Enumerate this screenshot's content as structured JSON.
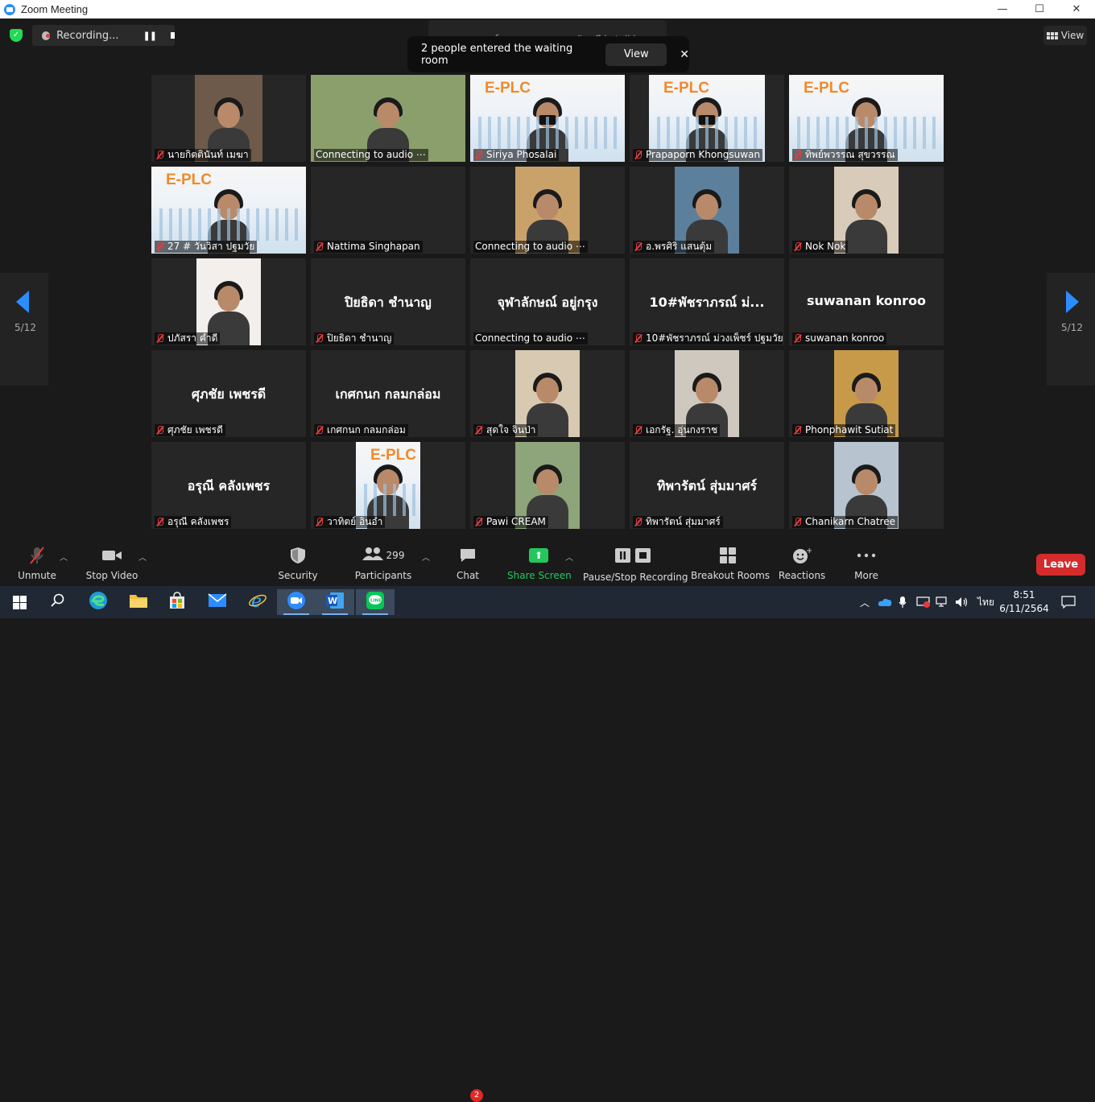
{
  "window": {
    "title": "Zoom Meeting",
    "controls": [
      "—",
      "☐",
      "✕"
    ]
  },
  "meeting_top": {
    "recording_label": "Recording...",
    "talking_text": "คณะครุศาสตร์อุตสาหกรรม มทร.ธัญบุรี is talking...",
    "waiting_message": "2 people entered the waiting room",
    "waiting_view": "View",
    "waiting_close": "✕",
    "view_label": "View"
  },
  "pagination": {
    "left": "5/12",
    "right": "5/12"
  },
  "tiles": [
    {
      "label": "นายกิตตินันท์ เมฆา",
      "muted": true,
      "video": "person",
      "bg": "#6d5a4a",
      "vx": 54,
      "vw": 84
    },
    {
      "label": "Connecting to audio ⋯",
      "muted": false,
      "video": "person",
      "bg": "#8a9f6b",
      "vx": 0,
      "vw": 192
    },
    {
      "label": "Siriya Phosalai",
      "muted": true,
      "video": "plc-mask",
      "vx": 0,
      "vw": 192
    },
    {
      "label": "Prapaporn Khongsuwan",
      "muted": true,
      "video": "plc-mask",
      "vx": 24,
      "vw": 144
    },
    {
      "label": "ทิพย์พวรรณ สุขวรรณ",
      "muted": true,
      "video": "plc",
      "vx": 0,
      "vw": 192
    },
    {
      "label": "27 # วันวิสา ปฐมวัย",
      "muted": true,
      "video": "plc",
      "vx": 0,
      "vw": 192
    },
    {
      "label": "Nattima Singhapan",
      "muted": true,
      "video": "none"
    },
    {
      "label": "Connecting to audio ⋯",
      "muted": false,
      "video": "person",
      "bg": "#c9a26a",
      "vx": 56,
      "vw": 80
    },
    {
      "label": "อ.พรศิริ แสนตุ้ม",
      "muted": true,
      "video": "person",
      "bg": "#5c7f9c",
      "vx": 56,
      "vw": 80
    },
    {
      "label": "Nok Nok",
      "muted": true,
      "video": "person",
      "bg": "#d9cbb9",
      "vx": 56,
      "vw": 80
    },
    {
      "label": "ปภัสรา คำดี",
      "muted": true,
      "video": "person",
      "bg": "#f2efec",
      "vx": 56,
      "vw": 80
    },
    {
      "label": "ปิยธิดา ชำนาญ",
      "muted": true,
      "video": "none",
      "big": "ปิยธิดา ชำนาญ"
    },
    {
      "label": "Connecting to audio ⋯",
      "muted": false,
      "video": "none",
      "big": "จุฬาลักษณ์ อยู่กรุง"
    },
    {
      "label": "10#พัชราภรณ์ ม่วงเพ็ชร์ ปฐมวัย",
      "muted": true,
      "video": "none",
      "big": "10#พัชราภรณ์ ม่..."
    },
    {
      "label": "suwanan konroo",
      "muted": true,
      "video": "none",
      "big": "suwanan konroo"
    },
    {
      "label": "ศุภชัย เพชรดี",
      "muted": true,
      "video": "none",
      "big": "ศุภชัย เพชรดี"
    },
    {
      "label": "เกศกนก กลมกล่อม",
      "muted": true,
      "video": "none",
      "big": "เกศกนก กลมกล่อม"
    },
    {
      "label": "สุดใจ จินป่า",
      "muted": true,
      "video": "person",
      "bg": "#d8c9b2",
      "vx": 56,
      "vw": 80
    },
    {
      "label": "เอกรัฐ. อุ่นกงราช",
      "muted": true,
      "video": "person",
      "bg": "#cfc8bf",
      "vx": 56,
      "vw": 80
    },
    {
      "label": "Phonphawit Sutiat",
      "muted": true,
      "video": "person",
      "bg": "#c79a4a",
      "vx": 56,
      "vw": 80
    },
    {
      "label": "อรุณี คลังเพชร",
      "muted": true,
      "video": "none",
      "big": "อรุณี คลังเพชร"
    },
    {
      "label": "วาทิตย์ อินอ่ำ",
      "muted": true,
      "video": "plc",
      "vx": 56,
      "vw": 80
    },
    {
      "label": "Pawi CREAM",
      "muted": true,
      "video": "person",
      "bg": "#8ea47a",
      "vx": 56,
      "vw": 80
    },
    {
      "label": "ทิพารัตน์ สุ่มมาศร์",
      "muted": true,
      "video": "none",
      "big": "ทิพารัตน์ สุ่มมาศร์"
    },
    {
      "label": "Chanikarn Chatree",
      "muted": true,
      "video": "person",
      "bg": "#b7c4cf",
      "vx": 56,
      "vw": 80
    }
  ],
  "toolbar": {
    "unmute": "Unmute",
    "stop_video": "Stop Video",
    "security": "Security",
    "participants": "Participants",
    "participants_count": "299",
    "chat": "Chat",
    "chat_badge": "2",
    "share_screen": "Share Screen",
    "pause_stop_recording": "Pause/Stop Recording",
    "breakout_rooms": "Breakout Rooms",
    "reactions": "Reactions",
    "more": "More",
    "leave": "Leave"
  },
  "taskbar": {
    "apps": [
      "windows-start",
      "search",
      "edge",
      "file-explorer",
      "store",
      "mail",
      "internet-explorer",
      "zoom",
      "word",
      "line"
    ],
    "language": "ไทย",
    "time": "8:51",
    "date": "6/11/2564"
  },
  "colors": {
    "accent": "#2d8cff",
    "share_green": "#23c85c",
    "leave_red": "#d42c2c",
    "mute_red": "#e23d3d"
  }
}
